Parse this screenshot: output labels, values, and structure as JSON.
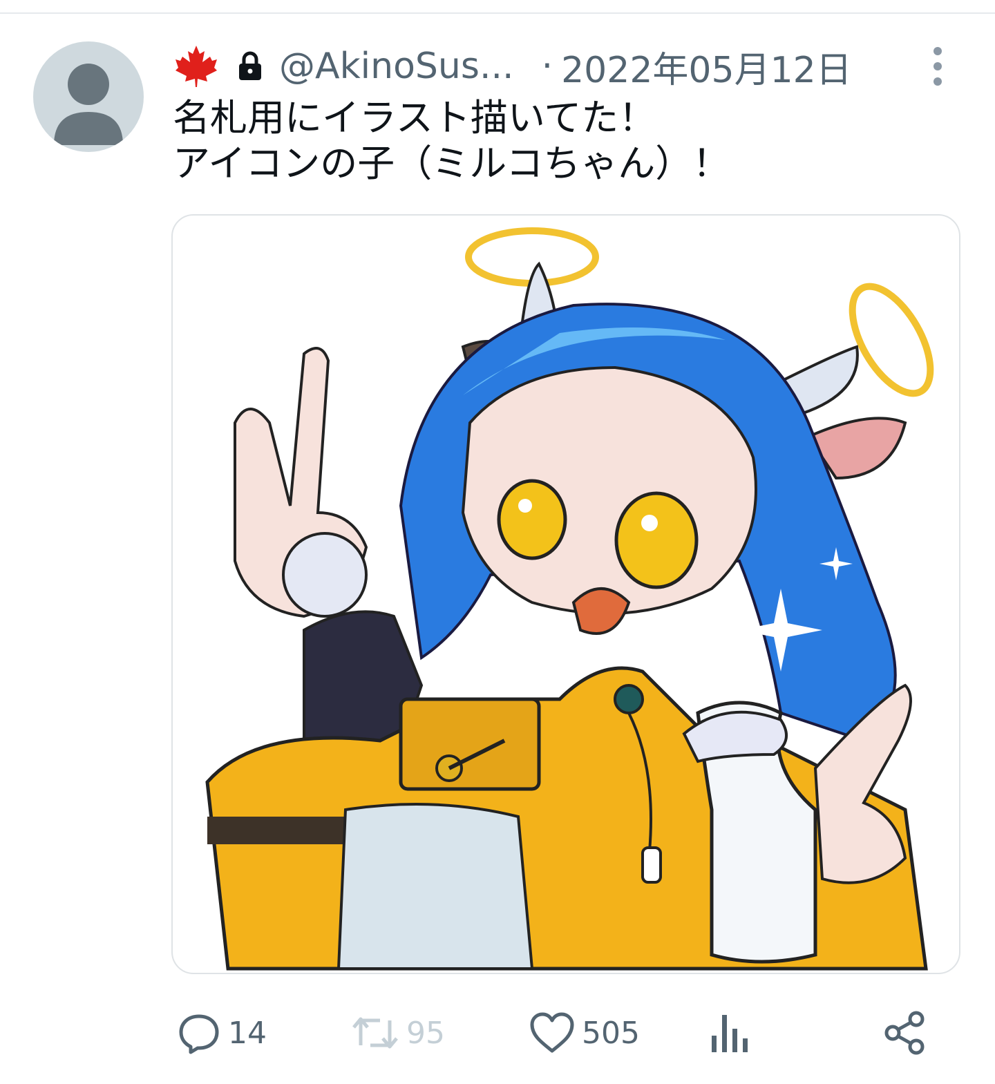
{
  "tweet": {
    "handle": "@AkinoSus...",
    "separator": "·",
    "date": "2022年05月12日",
    "text_lines": [
      "名札用にイラスト描いてた！",
      "アイコンの子（ミルコちゃん）！"
    ]
  },
  "actions": {
    "reply_count": "14",
    "retweet_count": "95",
    "like_count": "505"
  },
  "icons": {
    "leaf": "maple-leaf-icon",
    "lock": "lock-icon",
    "more": "more-vertical-icon",
    "reply": "reply-icon",
    "retweet": "retweet-icon",
    "like": "heart-icon",
    "views": "bar-chart-icon",
    "share": "share-icon"
  },
  "colors": {
    "leaf": "#e0201b",
    "text": "#0f1419",
    "muted": "#536471",
    "disabled": "#c4cfd6",
    "avatar_bg": "#cfd9de",
    "avatar_fg": "#6b7b85"
  }
}
